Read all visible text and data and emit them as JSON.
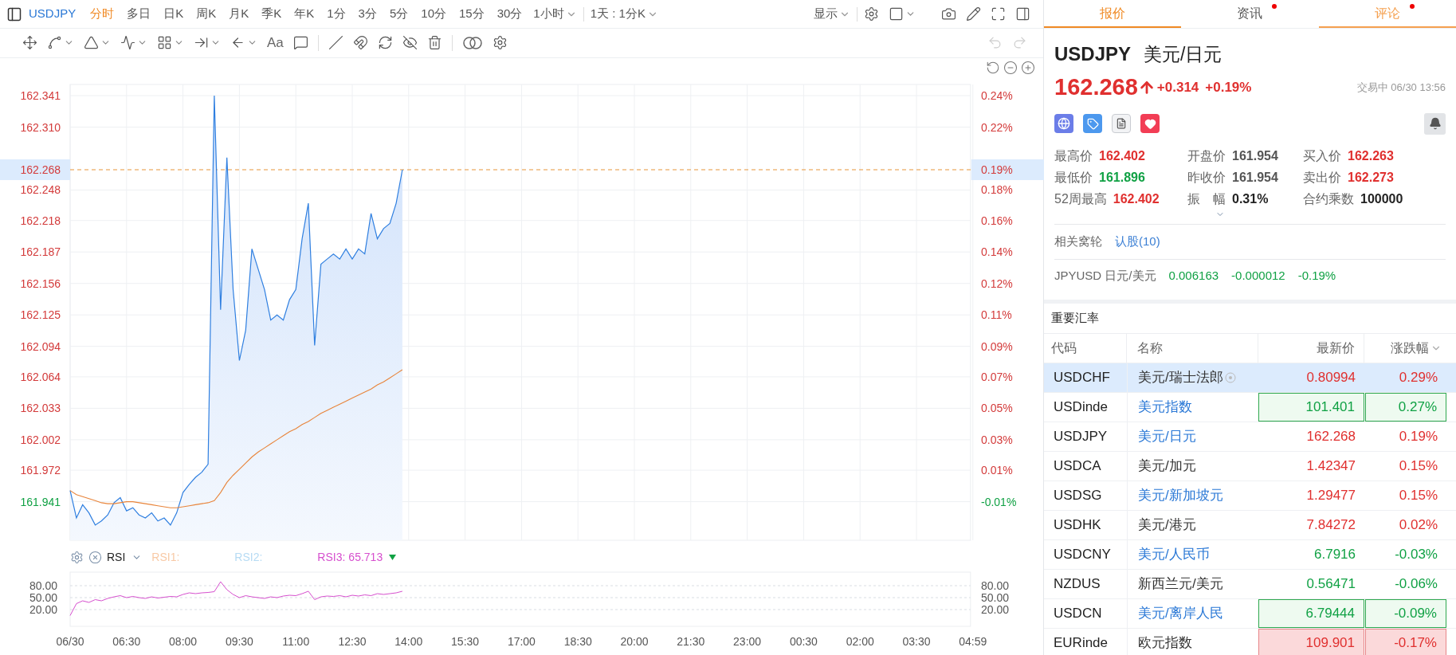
{
  "toolbar": {
    "symbol": "USDJPY",
    "periods": [
      {
        "label": "分时",
        "selected": true
      },
      {
        "label": "多日",
        "selected": false
      },
      {
        "label": "日K",
        "selected": false
      },
      {
        "label": "周K",
        "selected": false
      },
      {
        "label": "月K",
        "selected": false
      },
      {
        "label": "季K",
        "selected": false
      },
      {
        "label": "年K",
        "selected": false
      },
      {
        "label": "1分",
        "selected": false
      },
      {
        "label": "3分",
        "selected": false
      },
      {
        "label": "5分",
        "selected": false
      },
      {
        "label": "10分",
        "selected": false
      },
      {
        "label": "15分",
        "selected": false
      },
      {
        "label": "30分",
        "selected": false
      }
    ],
    "period_menu": "1小时",
    "range_menu": "1天 : 1分K",
    "display_menu": "显示"
  },
  "drawing_toolbar": {
    "text_tool": "Aa",
    "undo_enabled": false,
    "redo_enabled": false
  },
  "price_chart": {
    "chart_data": {
      "type": "line",
      "categories": [
        null,
        null,
        null,
        null,
        null,
        null,
        null,
        null,
        null,
        null,
        null,
        null,
        null,
        null,
        null,
        null,
        null,
        null,
        null,
        null,
        null,
        null,
        null,
        null,
        null,
        null,
        null,
        null,
        null,
        null,
        null,
        null,
        null,
        null,
        null,
        null,
        null,
        null,
        null,
        null,
        null,
        null,
        null,
        null,
        null,
        null,
        null,
        null,
        null,
        null,
        null,
        null,
        null,
        null,
        null,
        null,
        null,
        null,
        null,
        null,
        null,
        null,
        null,
        null,
        null,
        null,
        null,
        null,
        null,
        null,
        null,
        null,
        null,
        null,
        null,
        null,
        null,
        null,
        null,
        null,
        null,
        null,
        null,
        null,
        null,
        null,
        null,
        null,
        null,
        null,
        null,
        null,
        null,
        null,
        null,
        null,
        null,
        null,
        null,
        null,
        null,
        null,
        null,
        null,
        null,
        null,
        null,
        null,
        null,
        null,
        null,
        null,
        null,
        null,
        null,
        null,
        null,
        null,
        null,
        null,
        null,
        null,
        null,
        null,
        null,
        null,
        null,
        null,
        null,
        null,
        null,
        null,
        null,
        null,
        null,
        null,
        null,
        null,
        null,
        null,
        null,
        null,
        null,
        null,
        null
      ],
      "series": [
        {
          "color": "#2f7fe0",
          "values": [
            161.952,
            161.925,
            161.938,
            161.93,
            161.918,
            161.922,
            161.928,
            161.94,
            161.945,
            161.932,
            161.935,
            161.928,
            161.925,
            161.93,
            161.922,
            161.925,
            161.918,
            161.93,
            161.95,
            161.958,
            161.965,
            161.97,
            161.978,
            162.341,
            162.13,
            162.28,
            162.15,
            162.08,
            162.11,
            162.19,
            162.17,
            162.15,
            162.12,
            162.125,
            162.12,
            162.14,
            162.15,
            162.2,
            162.235,
            162.095,
            162.175,
            162.18,
            162.185,
            162.18,
            162.19,
            162.18,
            162.19,
            162.185,
            162.225,
            162.2,
            162.21,
            162.215,
            162.235,
            162.268,
            null,
            null,
            null,
            null,
            null,
            null,
            null,
            null,
            null,
            null,
            null,
            null,
            null,
            null,
            null,
            null,
            null,
            null,
            null,
            null,
            null,
            null,
            null,
            null,
            null,
            null,
            null,
            null,
            null,
            null,
            null,
            null,
            null,
            null,
            null,
            null,
            null,
            null,
            null,
            null,
            null,
            null,
            null,
            null,
            null,
            null,
            null,
            null,
            null,
            null,
            null,
            null,
            null,
            null,
            null,
            null,
            null,
            null,
            null,
            null,
            null,
            null,
            null,
            null,
            null,
            null,
            null,
            null,
            null,
            null,
            null,
            null,
            null,
            null,
            null,
            null,
            null,
            null,
            null,
            null,
            null,
            null,
            null,
            null,
            null,
            null,
            null,
            null,
            null,
            null,
            null
          ]
        },
        {
          "color": "#e8843a",
          "values": [
            161.952,
            161.948,
            161.946,
            161.944,
            161.942,
            161.94,
            161.939,
            161.939,
            161.94,
            161.941,
            161.941,
            161.94,
            161.939,
            161.938,
            161.937,
            161.936,
            161.935,
            161.935,
            161.936,
            161.937,
            161.938,
            161.939,
            161.94,
            161.942,
            161.95,
            161.96,
            161.967,
            161.973,
            161.979,
            161.985,
            161.99,
            161.994,
            161.998,
            162.002,
            162.006,
            162.01,
            162.013,
            162.017,
            162.02,
            162.024,
            162.028,
            162.031,
            162.034,
            162.037,
            162.04,
            162.043,
            162.046,
            162.049,
            162.052,
            162.056,
            162.059,
            162.063,
            162.067,
            162.071,
            null,
            null,
            null,
            null,
            null,
            null,
            null,
            null,
            null,
            null,
            null,
            null,
            null,
            null,
            null,
            null,
            null,
            null,
            null,
            null,
            null,
            null,
            null,
            null,
            null,
            null,
            null,
            null,
            null,
            null,
            null,
            null,
            null,
            null,
            null,
            null,
            null,
            null,
            null,
            null,
            null,
            null,
            null,
            null,
            null,
            null,
            null,
            null,
            null,
            null,
            null,
            null,
            null,
            null,
            null,
            null,
            null,
            null,
            null,
            null,
            null,
            null,
            null,
            null,
            null,
            null,
            null,
            null,
            null,
            null,
            null,
            null,
            null,
            null,
            null,
            null,
            null,
            null,
            null,
            null,
            null,
            null,
            null,
            null,
            null,
            null,
            null,
            null,
            null,
            null,
            null
          ]
        }
      ],
      "ylim": [
        161.903,
        162.352
      ],
      "grid": true,
      "ref_lines": [
        {
          "axis": "y",
          "value": 162.268,
          "color": "#e8963a"
        }
      ],
      "yticks": [
        {
          "value": 162.341,
          "label": "162.341"
        },
        {
          "value": 162.31,
          "label": "162.310"
        },
        {
          "value": 162.248,
          "label": "162.248"
        },
        {
          "value": 162.218,
          "label": "162.218"
        },
        {
          "value": 162.187,
          "label": "162.187"
        },
        {
          "value": 162.156,
          "label": "162.156"
        },
        {
          "value": 162.125,
          "label": "162.125"
        },
        {
          "value": 162.094,
          "label": "162.094"
        },
        {
          "value": 162.064,
          "label": "162.064"
        },
        {
          "value": 162.033,
          "label": "162.033"
        },
        {
          "value": 162.002,
          "label": "162.002"
        },
        {
          "value": 161.972,
          "label": "161.972"
        },
        {
          "value": 161.941,
          "label": "161.941"
        }
      ],
      "annotations": [
        "162.268"
      ]
    },
    "current_percent": "0.19%",
    "percent_labels": [
      {
        "text": "0.24%",
        "color": "#d33a3a"
      },
      {
        "text": "0.22%",
        "color": "#d33a3a"
      },
      {
        "text": "0.18%",
        "color": "#d33a3a"
      },
      {
        "text": "0.16%",
        "color": "#d33a3a"
      },
      {
        "text": "0.14%",
        "color": "#d33a3a"
      },
      {
        "text": "0.12%",
        "color": "#d33a3a"
      },
      {
        "text": "0.11%",
        "color": "#d33a3a"
      },
      {
        "text": "0.09%",
        "color": "#d33a3a"
      },
      {
        "text": "0.07%",
        "color": "#d33a3a"
      },
      {
        "text": "0.05%",
        "color": "#d33a3a"
      },
      {
        "text": "0.03%",
        "color": "#d33a3a"
      },
      {
        "text": "0.01%",
        "color": "#d33a3a"
      },
      {
        "text": "-0.01%",
        "color": "#10a144"
      }
    ]
  },
  "rsi": {
    "name": "RSI",
    "lines": [
      {
        "label": "RSI1:",
        "color": "#f8c9a5"
      },
      {
        "label": "RSI2:",
        "color": "#b6dbf4"
      },
      {
        "label": "RSI3:",
        "color": "#d64fce",
        "value": "65.713",
        "falling": true
      }
    ],
    "chart_data": {
      "type": "line",
      "categories": [
        "06/30",
        null,
        null,
        null,
        null,
        null,
        null,
        null,
        null,
        "06:30",
        null,
        null,
        null,
        null,
        null,
        null,
        null,
        null,
        "08:00",
        null,
        null,
        null,
        null,
        null,
        null,
        null,
        null,
        "09:30",
        null,
        null,
        null,
        null,
        null,
        null,
        null,
        null,
        "11:00",
        null,
        null,
        null,
        null,
        null,
        null,
        null,
        null,
        "12:30",
        null,
        null,
        null,
        null,
        null,
        null,
        null,
        null,
        "14:00",
        null,
        null,
        null,
        null,
        null,
        null,
        null,
        null,
        "15:30",
        null,
        null,
        null,
        null,
        null,
        null,
        null,
        null,
        "17:00",
        null,
        null,
        null,
        null,
        null,
        null,
        null,
        null,
        "18:30",
        null,
        null,
        null,
        null,
        null,
        null,
        null,
        null,
        "20:00",
        null,
        null,
        null,
        null,
        null,
        null,
        null,
        null,
        "21:30",
        null,
        null,
        null,
        null,
        null,
        null,
        null,
        null,
        "23:00",
        null,
        null,
        null,
        null,
        null,
        null,
        null,
        null,
        "00:30",
        null,
        null,
        null,
        null,
        null,
        null,
        null,
        null,
        "02:00",
        null,
        null,
        null,
        null,
        null,
        null,
        null,
        null,
        "03:30",
        null,
        null,
        null,
        null,
        null,
        null,
        null,
        null,
        "04:59"
      ],
      "series": [
        {
          "color": "#d64fce",
          "values": [
            5,
            35,
            42,
            38,
            45,
            42,
            48,
            52,
            55,
            50,
            53,
            50,
            48,
            52,
            49,
            51,
            53,
            52,
            58,
            62,
            60,
            62,
            63,
            65,
            90,
            70,
            58,
            50,
            55,
            52,
            50,
            48,
            52,
            50,
            54,
            56,
            55,
            60,
            66,
            45,
            52,
            54,
            53,
            55,
            52,
            56,
            54,
            57,
            55,
            60,
            58,
            60,
            62,
            66,
            null,
            null,
            null,
            null,
            null,
            null,
            null,
            null,
            null,
            null,
            null,
            null,
            null,
            null,
            null,
            null,
            null,
            null,
            null,
            null,
            null,
            null,
            null,
            null,
            null,
            null,
            null,
            null,
            null,
            null,
            null,
            null,
            null,
            null,
            null,
            null,
            null,
            null,
            null,
            null,
            null,
            null,
            null,
            null,
            null,
            null,
            null,
            null,
            null,
            null,
            null,
            null,
            null,
            null,
            null,
            null,
            null,
            null,
            null,
            null,
            null,
            null,
            null,
            null,
            null,
            null,
            null,
            null,
            null,
            null,
            null,
            null,
            null,
            null,
            null,
            null,
            null,
            null,
            null,
            null,
            null,
            null,
            null,
            null,
            null,
            null,
            null,
            null,
            null,
            null,
            null
          ]
        }
      ],
      "ylim": [
        -22,
        114
      ],
      "grid": true,
      "yticks": [
        {
          "value": 80,
          "label": "80.00"
        },
        {
          "value": 50,
          "label": "50.00"
        },
        {
          "value": 20,
          "label": "20.00"
        }
      ]
    }
  },
  "tabs": [
    {
      "label": "报价",
      "selected": true,
      "hovered": false,
      "unread": false
    },
    {
      "label": "资讯",
      "selected": false,
      "hovered": false,
      "unread": true
    },
    {
      "label": "评论",
      "selected": false,
      "hovered": true,
      "unread": true
    }
  ],
  "quote": {
    "code": "USDJPY",
    "name": "美元/日元",
    "price": "162.268",
    "color": "#e0302f",
    "rising": true,
    "change": "+0.314",
    "change_pct": "+0.19%",
    "status": "交易中 06/30 13:56",
    "stats": [
      {
        "label": "最高价",
        "value": "162.402",
        "color": "#e0302f"
      },
      {
        "label": "开盘价",
        "value": "161.954",
        "color": "#555555"
      },
      {
        "label": "买入价",
        "value": "162.263",
        "color": "#e0302f"
      },
      {
        "label": "最低价",
        "value": "161.896",
        "color": "#10a144"
      },
      {
        "label": "昨收价",
        "value": "161.954",
        "color": "#555555"
      },
      {
        "label": "卖出价",
        "value": "162.273",
        "color": "#e0302f"
      },
      {
        "label": "52周最高",
        "value": "162.402",
        "color": "#e0302f"
      },
      {
        "label": "振　幅",
        "value": "0.31%",
        "color": "#222222"
      },
      {
        "label": "合约乘数",
        "value": "100000",
        "color": "#222222"
      }
    ],
    "warrants_label": "相关窝轮",
    "warrants_link": "认股(10)",
    "inverse": {
      "label": "JPYUSD 日元/美元",
      "price": "0.006163",
      "change": "-0.000012",
      "change_pct": "-0.19%",
      "color": "#10a144"
    }
  },
  "rates": {
    "title": "重要汇率",
    "columns": [
      "代码",
      "名称",
      "最新价",
      "涨跌幅"
    ],
    "rows": [
      {
        "code": "USDCHF",
        "name": "美元/瑞士法郎",
        "price": "0.80994",
        "change": "0.29%",
        "color": "#e0302f",
        "linked": false,
        "selected": true,
        "flashing": false
      },
      {
        "code": "USDinde",
        "name": "美元指数",
        "price": "101.401",
        "change": "0.27%",
        "color": "#10a144",
        "linked": true,
        "selected": false,
        "flashing": true
      },
      {
        "code": "USDJPY",
        "name": "美元/日元",
        "price": "162.268",
        "change": "0.19%",
        "color": "#e0302f",
        "linked": true,
        "selected": false,
        "flashing": false
      },
      {
        "code": "USDCA",
        "name": "美元/加元",
        "price": "1.42347",
        "change": "0.15%",
        "color": "#e0302f",
        "linked": false,
        "selected": false,
        "flashing": false
      },
      {
        "code": "USDSG",
        "name": "美元/新加坡元",
        "price": "1.29477",
        "change": "0.15%",
        "color": "#e0302f",
        "linked": true,
        "selected": false,
        "flashing": false
      },
      {
        "code": "USDHK",
        "name": "美元/港元",
        "price": "7.84272",
        "change": "0.02%",
        "color": "#e0302f",
        "linked": false,
        "selected": false,
        "flashing": false
      },
      {
        "code": "USDCNY",
        "name": "美元/人民币",
        "price": "6.7916",
        "change": "-0.03%",
        "color": "#10a144",
        "linked": true,
        "selected": false,
        "flashing": false
      },
      {
        "code": "NZDUS",
        "name": "新西兰元/美元",
        "price": "0.56471",
        "change": "-0.06%",
        "color": "#10a144",
        "linked": false,
        "selected": false,
        "flashing": false
      },
      {
        "code": "USDCN",
        "name": "美元/离岸人民",
        "price": "6.79444",
        "change": "-0.09%",
        "color": "#10a144",
        "linked": true,
        "selected": false,
        "flashing": true
      },
      {
        "code": "EURinde",
        "name": "欧元指数",
        "price": "109.901",
        "change": "-0.17%",
        "color": "#e0302f",
        "linked": false,
        "selected": false,
        "flashing": true
      }
    ]
  }
}
